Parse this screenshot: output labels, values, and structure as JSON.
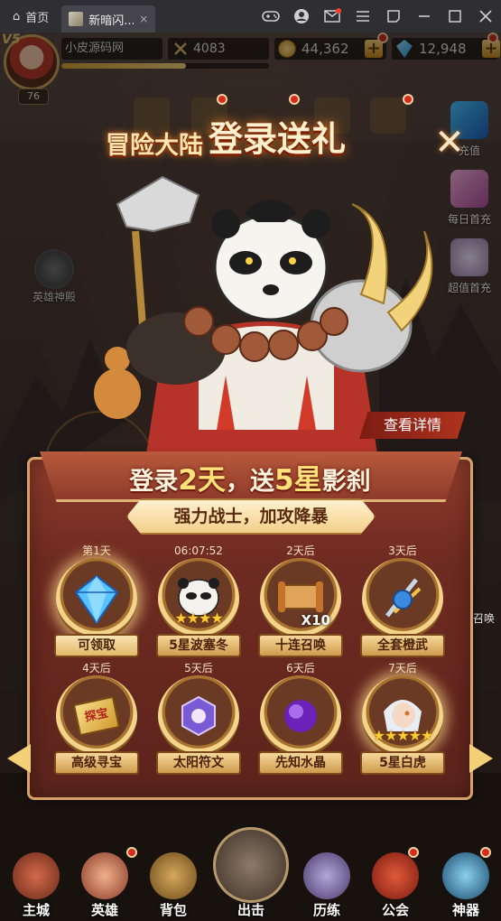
{
  "browser": {
    "home_tab": "首页",
    "game_tab": "新暗闪...",
    "close": "×",
    "controls": [
      "gamepad-icon",
      "user-icon",
      "mail-icon",
      "menu-icon",
      "pin-icon",
      "minimize-icon",
      "maximize-icon",
      "close-icon"
    ]
  },
  "hud": {
    "vip": "V5",
    "player_name": "小皮源码网",
    "level": "76",
    "power": "4083",
    "exp_fraction": 0.6,
    "gold": "44,362",
    "diamonds": "12,948",
    "plus": "+"
  },
  "side_right": [
    "充值",
    "每日首充",
    "超值首充"
  ],
  "side_left": "英雄神殿",
  "banner": {
    "title_small": "冒险大陆",
    "title_big": "登录送礼",
    "detail_button": "查看详情",
    "close": "✕"
  },
  "panel": {
    "headline_pre": "登录",
    "headline_num1": "2天",
    "headline_mid": "，送",
    "headline_num2": "5星",
    "headline_post": "影刹",
    "subtitle": "强力战士，加攻降暴"
  },
  "rewards": [
    {
      "day": "第1天",
      "name": "可领取",
      "icon": "blue-diamond-icon"
    },
    {
      "day": "06:07:52",
      "name": "5星波塞冬",
      "icon": "panda-hero-icon",
      "stars": "★★★★"
    },
    {
      "day": "2天后",
      "name": "十连召唤",
      "icon": "scroll-icon",
      "extra": "X10"
    },
    {
      "day": "3天后",
      "name": "全套橙武",
      "icon": "weapons-icon"
    },
    {
      "day": "4天后",
      "name": "高级寻宝",
      "icon": "treasure-ticket-icon",
      "ticket_text": "探宝"
    },
    {
      "day": "5天后",
      "name": "太阳符文",
      "icon": "sun-rune-icon"
    },
    {
      "day": "6天后",
      "name": "先知水晶",
      "icon": "purple-crystal-icon"
    },
    {
      "day": "7天后",
      "name": "5星白虎",
      "icon": "white-tiger-hero-icon",
      "stars": "★★★★★"
    }
  ],
  "edge_label": "召唤",
  "bottom_nav": [
    "主城",
    "英雄",
    "背包",
    "出击",
    "历练",
    "公会",
    "神器"
  ],
  "colors": {
    "accent_gold": "#f3cf78",
    "panel_red": "#6f2b21",
    "notify_red": "#d62b1f"
  }
}
